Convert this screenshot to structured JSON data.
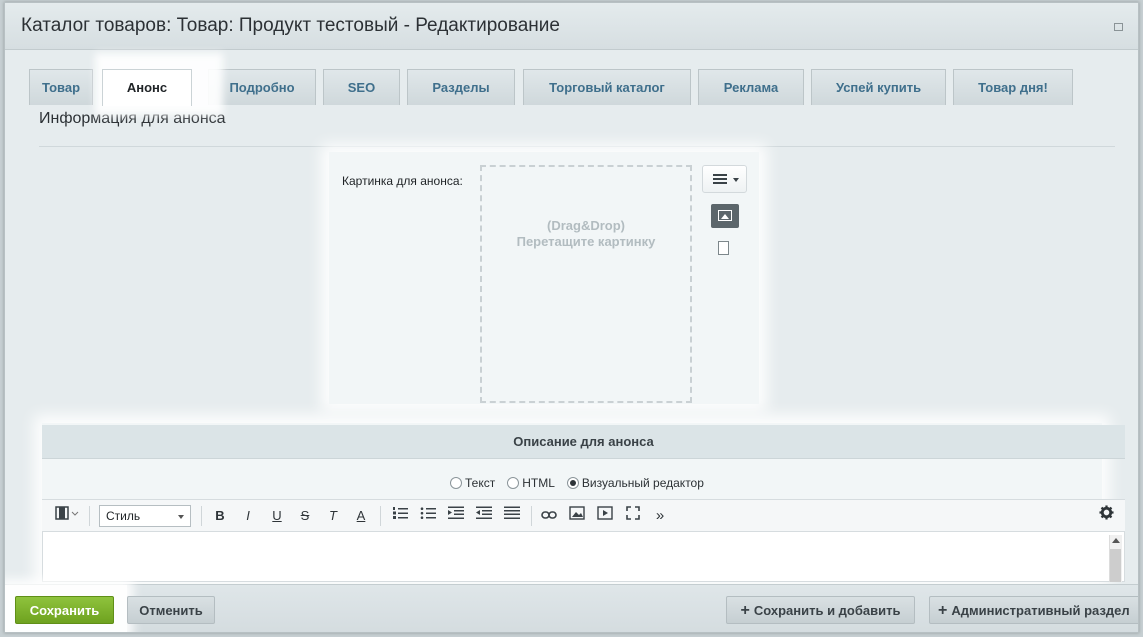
{
  "window": {
    "title": "Каталог товаров: Товар: Продукт тестовый - Редактирование"
  },
  "tabs": [
    {
      "label": "Товар"
    },
    {
      "label": "Анонс"
    },
    {
      "label": "Подробно"
    },
    {
      "label": "SEO"
    },
    {
      "label": "Разделы"
    },
    {
      "label": "Торговый каталог"
    },
    {
      "label": "Реклама"
    },
    {
      "label": "Успей купить"
    },
    {
      "label": "Товар дня!"
    }
  ],
  "active_tab": "Анонс",
  "section": {
    "title": "Информация для анонса"
  },
  "image_field": {
    "label": "Картинка для анонса:",
    "dropzone_line1": "(Drag&Drop)",
    "dropzone_line2": "Перетащите картинку"
  },
  "description": {
    "header": "Описание для анонса",
    "modes": [
      {
        "label": "Текст",
        "checked": false
      },
      {
        "label": "HTML",
        "checked": false
      },
      {
        "label": "Визуальный редактор",
        "checked": true
      }
    ]
  },
  "editor_toolbar": {
    "style_select": "Стиль",
    "bold": "B",
    "italic": "I",
    "underline": "U",
    "strike": "S",
    "clear_format": "T",
    "font_color": "A",
    "more": "»"
  },
  "footer": {
    "save": "Сохранить",
    "cancel": "Отменить",
    "save_add": "Сохранить и добавить",
    "admin": "Административный раздел"
  },
  "colors": {
    "save_button": "#7bb12a",
    "tab_text": "#3f6f8c",
    "background": "#e6ecee"
  }
}
